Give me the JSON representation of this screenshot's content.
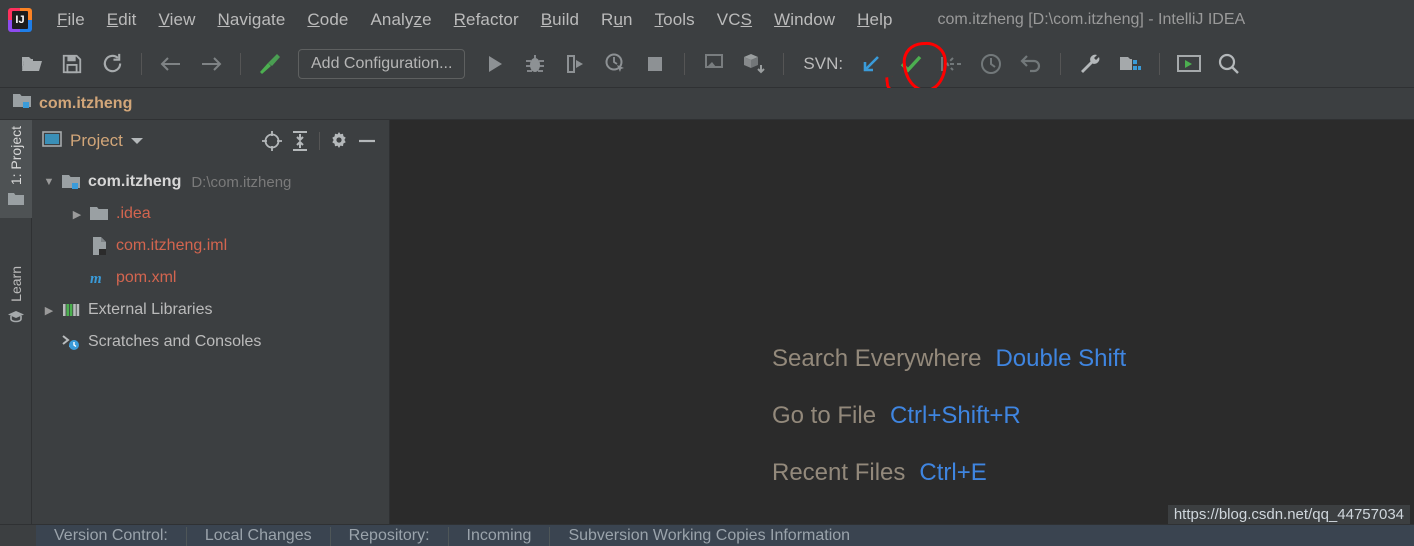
{
  "window": {
    "title": "com.itzheng [D:\\com.itzheng] - IntelliJ IDEA",
    "logo_icon": "intellij-idea-logo"
  },
  "menubar": {
    "items": [
      {
        "label": "File",
        "mnemonic": "F"
      },
      {
        "label": "Edit",
        "mnemonic": "E"
      },
      {
        "label": "View",
        "mnemonic": "V"
      },
      {
        "label": "Navigate",
        "mnemonic": "N"
      },
      {
        "label": "Code",
        "mnemonic": "C"
      },
      {
        "label": "Analyze",
        "mnemonic": "z"
      },
      {
        "label": "Refactor",
        "mnemonic": "R"
      },
      {
        "label": "Build",
        "mnemonic": "B"
      },
      {
        "label": "Run",
        "mnemonic": "u"
      },
      {
        "label": "Tools",
        "mnemonic": "T"
      },
      {
        "label": "VCS",
        "mnemonic": "S"
      },
      {
        "label": "Window",
        "mnemonic": "W"
      },
      {
        "label": "Help",
        "mnemonic": "H"
      }
    ]
  },
  "toolbar": {
    "open_icon": "open-folder-icon",
    "save_icon": "save-all-icon",
    "sync_icon": "sync-refresh-icon",
    "back_icon": "arrow-back-icon",
    "forward_icon": "arrow-forward-icon",
    "build_icon": "build-hammer-icon",
    "config_label": "Add Configuration...",
    "run_icon": "run-play-icon",
    "debug_icon": "debug-bug-icon",
    "run_with_coverage_icon": "run-with-coverage-icon",
    "profile_icon": "profiler-icon",
    "stop_icon": "stop-square-icon",
    "attach_icon": "attach-debugger-icon",
    "package_icon": "package-download-icon",
    "svn_label": "SVN:",
    "update_icon": "svn-update-arrow-icon",
    "commit_icon": "svn-commit-check-icon",
    "push_icon": "svn-push-icon",
    "history_icon": "svn-history-clock-icon",
    "rollback_icon": "svn-rollback-undo-icon",
    "settings_icon": "wrench-settings-icon",
    "project-structure_icon": "project-structure-icon",
    "presentation_icon": "presentation-window-icon",
    "search_icon": "search-magnifier-icon"
  },
  "annotation": {
    "shape": "red-hand-drawn-circle",
    "target": "svn-commit-check-icon",
    "color": "#ff0000"
  },
  "breadcrumb": {
    "icon": "project-module-folder-icon",
    "label": "com.itzheng"
  },
  "left_tool_tabs": [
    {
      "label": "1: Project",
      "icon": "folder-icon",
      "active": true
    },
    {
      "label": "Learn",
      "icon": "graduation-cap-icon",
      "active": false
    }
  ],
  "project_panel": {
    "view_icon": "project-view-icon",
    "title": "Project",
    "dropdown_icon": "chevron-down-icon",
    "locate_icon": "scroll-from-source-target-icon",
    "collapse_icon": "collapse-all-icon",
    "settings_icon": "gear-icon",
    "hide_icon": "hide-minimize-icon",
    "tree": [
      {
        "label": "com.itzheng",
        "sub": "D:\\com.itzheng",
        "icon": "project-root-folder-icon",
        "indent": 0,
        "arrow": "expanded",
        "style": "bold"
      },
      {
        "label": ".idea",
        "sub": "",
        "icon": "folder-icon",
        "indent": 1,
        "arrow": "collapsed",
        "style": "red"
      },
      {
        "label": "com.itzheng.iml",
        "sub": "",
        "icon": "iml-module-file-icon",
        "indent": 1,
        "arrow": "none",
        "style": "red"
      },
      {
        "label": "pom.xml",
        "sub": "",
        "icon": "maven-pom-icon",
        "indent": 1,
        "arrow": "none",
        "style": "red"
      },
      {
        "label": "External Libraries",
        "sub": "",
        "icon": "external-libraries-icon",
        "indent": 0,
        "arrow": "collapsed",
        "style": "normal"
      },
      {
        "label": "Scratches and Consoles",
        "sub": "",
        "icon": "scratches-consoles-icon",
        "indent": 0,
        "arrow": "none",
        "style": "normal"
      }
    ]
  },
  "editor_hints": [
    {
      "name": "Search Everywhere",
      "key": "Double Shift"
    },
    {
      "name": "Go to File",
      "key": "Ctrl+Shift+R"
    },
    {
      "name": "Recent Files",
      "key": "Ctrl+E"
    }
  ],
  "bottom_bar": {
    "tabs": [
      {
        "label": "Version Control:"
      },
      {
        "label": "Local Changes"
      },
      {
        "label": "Repository:"
      },
      {
        "label": "Incoming"
      },
      {
        "label": "Subversion Working Copies Information"
      }
    ]
  },
  "watermark": {
    "text": "https://blog.csdn.net/qq_44757034"
  },
  "colors": {
    "panel_bg": "#3c3f41",
    "editor_bg": "#2b2b2b",
    "accent_blue": "#3f85e0",
    "vcs_red": "#d3654f",
    "title_orange": "#d2a679",
    "annotation_red": "#ff0000"
  }
}
